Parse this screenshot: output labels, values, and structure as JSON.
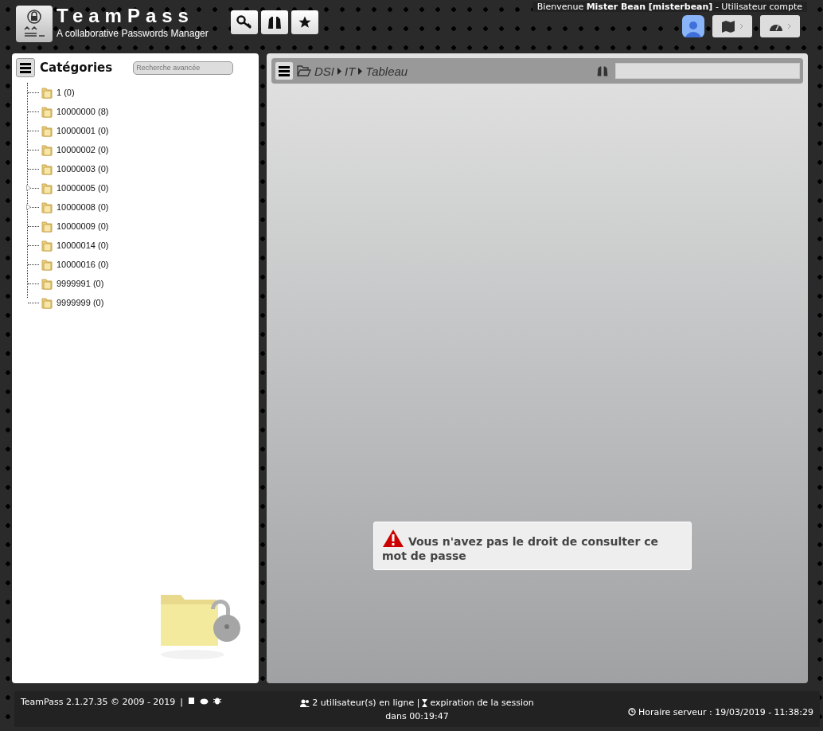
{
  "header": {
    "title": "TeamPass",
    "subtitle": "A collaborative Passwords Manager",
    "welcome": "Bienvenue **Mister Bean [misterbean]** - Utilisateur compte"
  },
  "sidebar": {
    "title": "Catégories",
    "search": {
      "placeholder": "Recherche avancée"
    },
    "tree": [
      {
        "label": "1 (0)",
        "expandable": false
      },
      {
        "label": "10000000 (8)",
        "expandable": false
      },
      {
        "label": "10000001 (0)",
        "expandable": false
      },
      {
        "label": "10000002 (0)",
        "expandable": false
      },
      {
        "label": "10000003 (0)",
        "expandable": false
      },
      {
        "label": "10000005 (0)",
        "expandable": true
      },
      {
        "label": "10000008 (0)",
        "expandable": true
      },
      {
        "label": "10000009 (0)",
        "expandable": false
      },
      {
        "label": "10000014 (0)",
        "expandable": false
      },
      {
        "label": "10000016 (0)",
        "expandable": false
      },
      {
        "label": "9999991 (0)",
        "expandable": false
      },
      {
        "label": "9999999 (0)",
        "expandable": false
      }
    ]
  },
  "breadcrumb": [
    "DSI",
    "IT",
    "Tableau"
  ],
  "message": "Vous n'avez pas le droit de consulter ce mot de passe",
  "footer": {
    "version": "TeamPass 2.1.27.35 © 2009 - 2019",
    "separator": "|",
    "online": "2 utilisateur(s) en ligne | ",
    "expiration": "expiration de la session",
    "countdown": "dans 00:19:47",
    "server_time": "Horaire serveur : 19/03/2019 - 11:38:29"
  }
}
